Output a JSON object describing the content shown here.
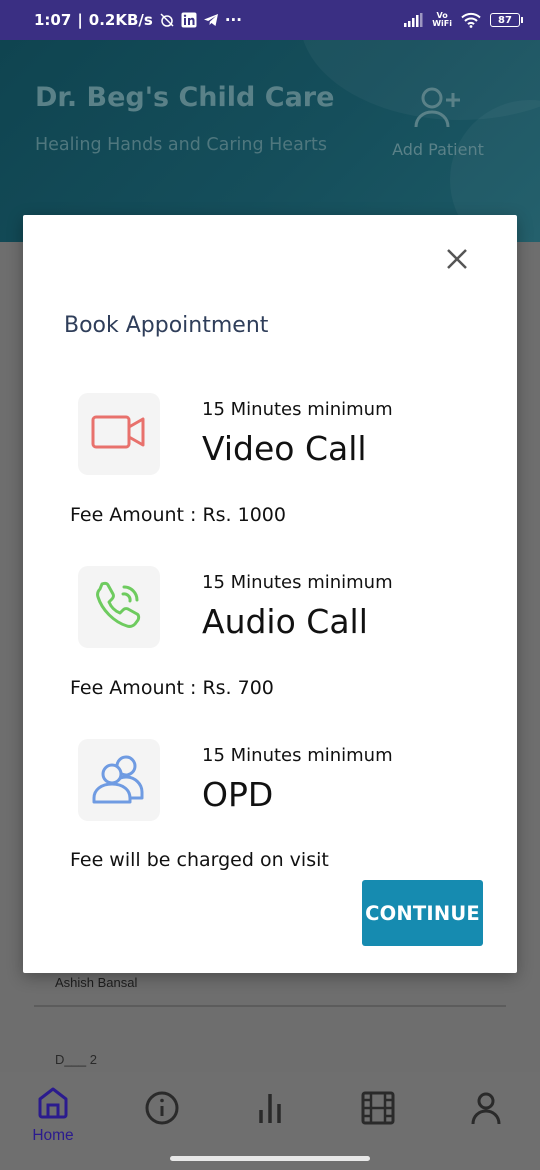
{
  "status_bar": {
    "time": "1:07",
    "net_speed": "0.2KB/s",
    "more": "···",
    "vowifi_top": "Vo",
    "vowifi_bottom": "WiFi",
    "battery": "87"
  },
  "header": {
    "title": "Dr. Beg's Child Care",
    "subtitle": "Healing Hands and Caring Hearts",
    "add_patient_label": "Add Patient"
  },
  "background": {
    "patient_name": "Ashish Bansal",
    "next_item_text": "D___ 2"
  },
  "modal": {
    "title": "Book Appointment",
    "options": [
      {
        "duration": "15 Minutes minimum",
        "name": "Video Call",
        "fee": "Fee Amount : Rs. 1000",
        "icon": "video-camera-icon",
        "icon_color": "#e8716c"
      },
      {
        "duration": "15 Minutes minimum",
        "name": "Audio Call",
        "fee": "Fee Amount : Rs. 700",
        "icon": "phone-call-icon",
        "icon_color": "#6ecb5f"
      },
      {
        "duration": "15 Minutes minimum",
        "name": "OPD",
        "fee": "Fee will be charged on visit",
        "icon": "users-icon",
        "icon_color": "#6f9be2"
      }
    ],
    "continue_label": "CONTINUE"
  },
  "bottom_nav": {
    "items": [
      {
        "label": "Home",
        "icon": "home-icon",
        "active": true
      },
      {
        "label": "",
        "icon": "info-icon"
      },
      {
        "label": "",
        "icon": "bar-chart-icon"
      },
      {
        "label": "",
        "icon": "film-icon"
      },
      {
        "label": "",
        "icon": "profile-icon"
      }
    ]
  },
  "colors": {
    "status_bar": "#3a2f83",
    "continue_button": "#168bb0",
    "nav_active": "#2b1b8e"
  }
}
